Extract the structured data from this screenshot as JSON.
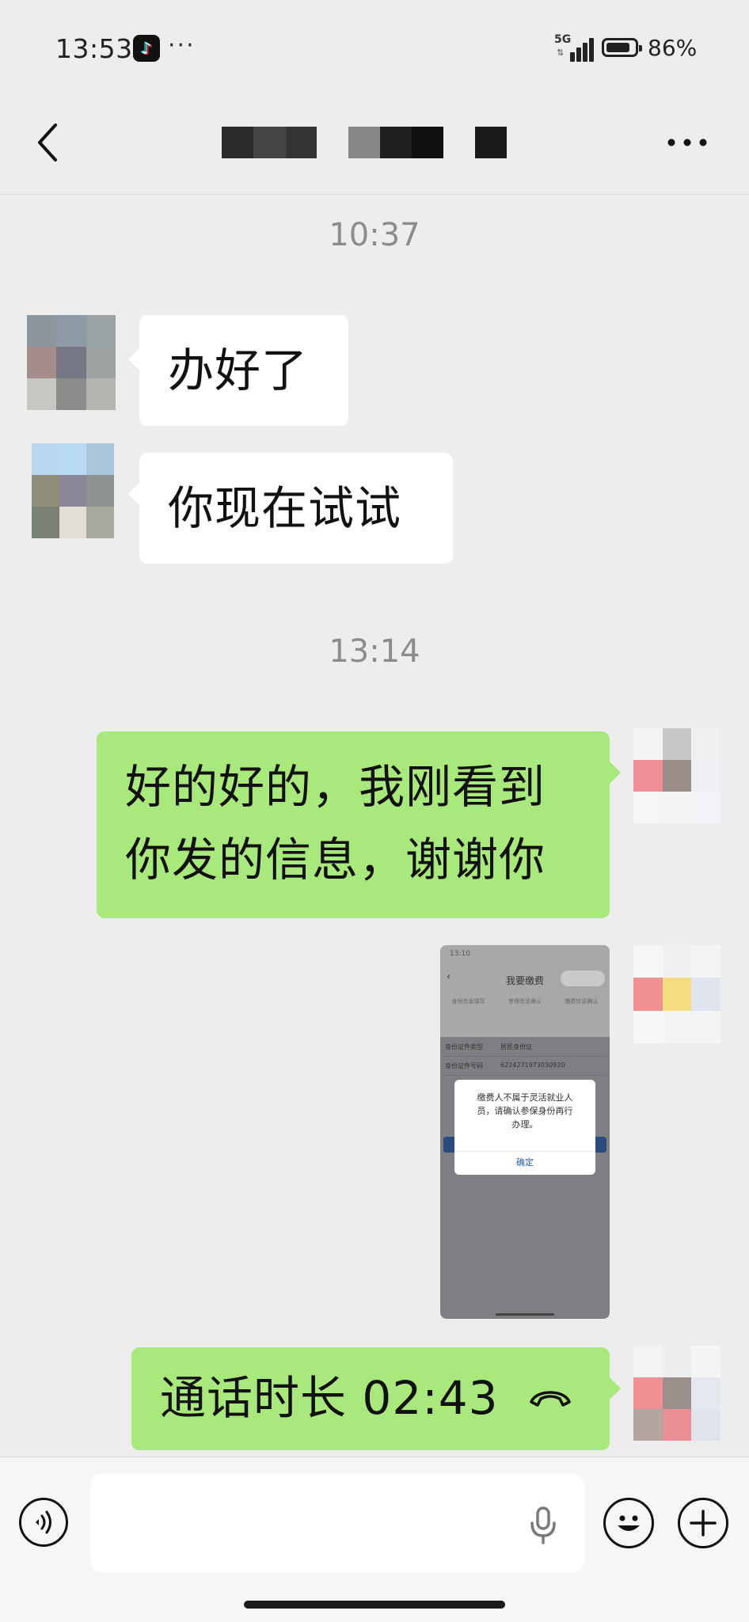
{
  "status_bar": {
    "time": "13:53",
    "more": "···",
    "network": "5G",
    "battery_level": 0.86,
    "battery_percent": "86%"
  },
  "nav": {
    "back_icon": "chevron-left-icon",
    "more_icon": "ellipsis-icon"
  },
  "messages": [
    {
      "type": "timestamp",
      "text": "10:37"
    },
    {
      "type": "text",
      "side": "left",
      "text": "办好了"
    },
    {
      "type": "text",
      "side": "left",
      "text": "你现在试试"
    },
    {
      "type": "timestamp",
      "text": "13:14"
    },
    {
      "type": "text",
      "side": "right",
      "lines": [
        "好的好的，我刚看到",
        "你发的信息，谢谢你"
      ]
    },
    {
      "type": "image",
      "side": "right",
      "screenshot": {
        "time": "13:10",
        "title": "我要缴费",
        "steps": [
          "身份信息填写",
          "参保信息确认",
          "缴费信息确认"
        ],
        "rows": [
          {
            "label": "身份证件类型",
            "value": "居民身份证"
          },
          {
            "label": "身份证件号码",
            "value": "6224271973030920"
          }
        ],
        "dialog_lines": [
          "缴费人不属于灵活就业人",
          "员，请确认参保身份再行",
          "办理。"
        ],
        "dialog_ok": "确定"
      }
    },
    {
      "type": "call",
      "side": "right",
      "text": "通话时长 02:43"
    }
  ],
  "input_bar": {
    "voice_icon": "voice-icon",
    "placeholder": "",
    "mic_icon": "mic-icon",
    "emoji_icon": "emoji-icon",
    "plus_icon": "plus-icon"
  },
  "colors": {
    "background": "#ededed",
    "bubble_right": "#a9e87c",
    "bubble_left": "#ffffff",
    "timestamp": "#8c8c8c"
  }
}
